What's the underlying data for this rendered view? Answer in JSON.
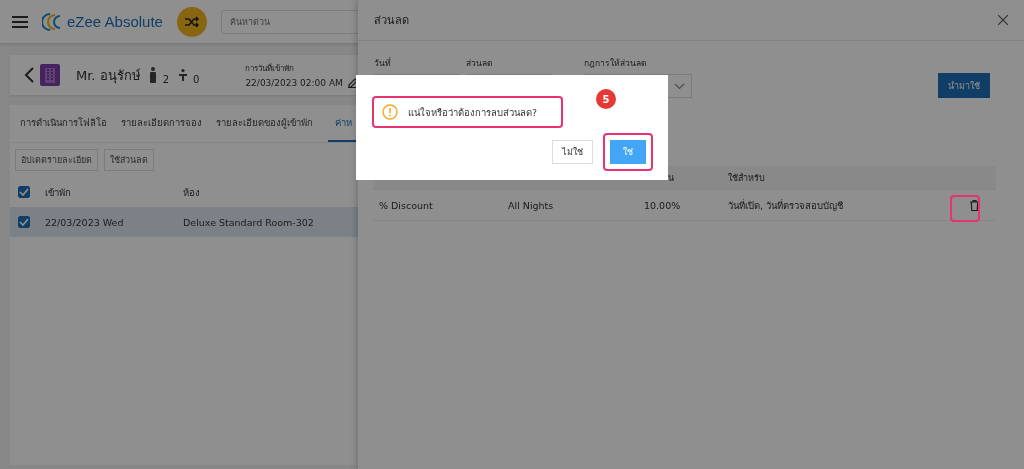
{
  "app": {
    "brand": "eZee Absolute",
    "search": {
      "placeholder": "ค้นหาด่วน"
    }
  },
  "guest": {
    "name": "Mr. อนุรักษ์",
    "adults": "2",
    "children": "0",
    "checkin_label": "การวันที่เข้าพัก",
    "checkin_value": "22/03/2023 02:00 AM"
  },
  "tabs": [
    {
      "label": "การดำเนินการโฟลิโอ",
      "selected": false
    },
    {
      "label": "รายละเอียดการจอง",
      "selected": false
    },
    {
      "label": "รายละเอียดของผู้เข้าพัก",
      "selected": false
    },
    {
      "label": "ค่าห",
      "selected": true
    }
  ],
  "actions": [
    "อัปเดตรายละเอียด",
    "ใช้ส่วนลด"
  ],
  "stay_table": {
    "header_checked": true,
    "columns": [
      "เข้าพัก",
      "ห้อง"
    ],
    "rows": [
      {
        "checked": true,
        "selected": true,
        "cells": [
          "22/03/2023 Wed",
          "Deluxe Standard Room-302"
        ]
      }
    ]
  },
  "drawer": {
    "title": "ส่วนลด",
    "fields": [
      {
        "label": "วันที่",
        "kind": "text"
      },
      {
        "label": "ส่วนลด",
        "kind": "text"
      },
      {
        "label": "กฎการให้ส่วนลด",
        "kind": "select"
      }
    ],
    "apply_button": "นำมาใช้",
    "table": {
      "column_3": "น",
      "column_4": "ใช้สำหรับ",
      "rows": [
        {
          "cells": [
            "% Discount",
            "All Nights",
            "10.00%",
            "วันที่เปิด, วันที่ตรวจสอบบัญชี"
          ],
          "delete_highlighted": true
        }
      ]
    }
  },
  "dialog": {
    "message": "แน่ใจหรือว่าต้องการลบส่วนลด?",
    "message_highlighted": true,
    "buttons": [
      {
        "label": "ไม่ใช่",
        "kind": "secondary",
        "highlighted": false
      },
      {
        "label": "ใช่",
        "kind": "primary",
        "highlighted": true
      }
    ]
  },
  "annotation": {
    "step": "5"
  }
}
